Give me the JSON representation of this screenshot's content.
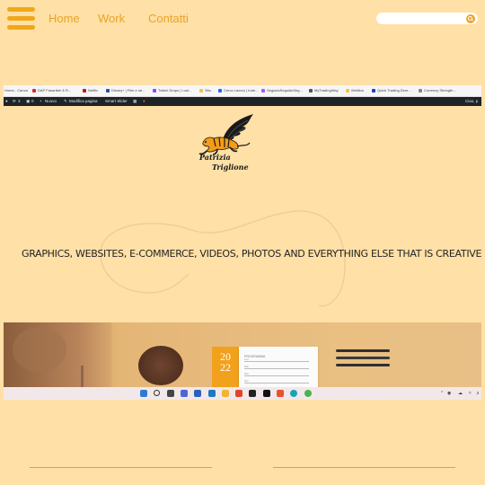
{
  "header": {
    "nav": [
      "Home",
      "Work",
      "Contatti"
    ],
    "search": {
      "placeholder": ""
    }
  },
  "browser": {
    "bookmarks": [
      "Home - Canva",
      "DAP Fanartbel & R...",
      "Netflix",
      "Disney+ | Film e sé...",
      "Twitch Drops | Lust...",
      "Sito",
      "Cerco Lavoro | Inde...",
      "SeguidoSeguidoSeg...",
      "MyTradingWay",
      "Welilioo",
      "Quick Trading Dem...",
      "Currency Strength..."
    ],
    "admin_bar": {
      "comments_count": "3",
      "pending_count": "0",
      "new_label": "Nuovo",
      "edit_label": "Modifica pagina",
      "slider_label": "Smart Slider",
      "greeting": "Ciao, p"
    },
    "logo": {
      "line1": "Patrizia",
      "line2": "Triglione"
    },
    "tagline": "Graphics, websites, e-commerce, videos, photos and everything else that is creative",
    "desk": {
      "calendar": {
        "year_top": "20",
        "year_bottom": "22",
        "header": "PROGRAMMA"
      },
      "notebook_lines": [
        "Lun",
        "Mar",
        "Mer",
        "Gio"
      ]
    }
  },
  "colors": {
    "background": "#ffe0a6",
    "accent": "#f0a818",
    "text_dark": "#232323"
  }
}
